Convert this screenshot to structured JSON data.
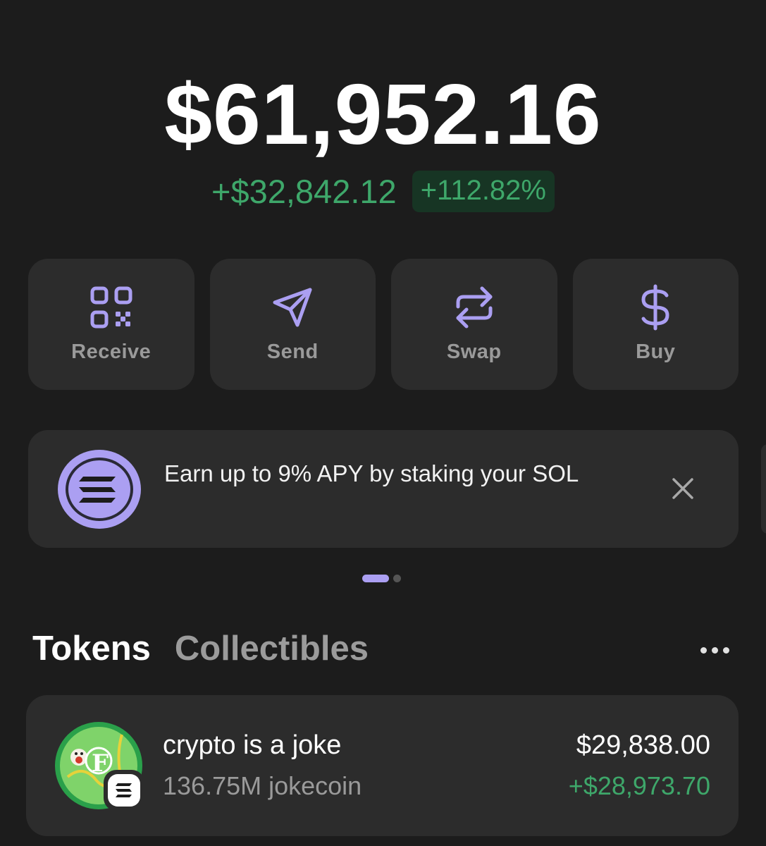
{
  "portfolio": {
    "balance": "$61,952.16",
    "change_amount": "+$32,842.12",
    "change_percent": "+112.82%"
  },
  "actions": [
    {
      "label": "Receive",
      "icon": "qr-code-icon"
    },
    {
      "label": "Send",
      "icon": "send-arrow-icon"
    },
    {
      "label": "Swap",
      "icon": "swap-arrows-icon"
    },
    {
      "label": "Buy",
      "icon": "dollar-icon"
    }
  ],
  "banner": {
    "text": "Earn up to 9% APY by staking your SOL",
    "icon": "solana-logo-icon",
    "close_icon": "close-icon"
  },
  "carousel": {
    "total_pages": 2,
    "active_page": 1
  },
  "tabs": [
    {
      "label": "Tokens",
      "active": true
    },
    {
      "label": "Collectibles",
      "active": false
    }
  ],
  "tokens": [
    {
      "name": "crypto is a joke",
      "amount": "136.75M jokecoin",
      "value": "$29,838.00",
      "change": "+$28,973.70",
      "icon": "jokecoin-avatar",
      "chain_icon": "solana-badge-icon"
    }
  ],
  "colors": {
    "background": "#1c1c1c",
    "card": "#2c2c2c",
    "accent": "#ab9ff2",
    "positive": "#3ea76a",
    "positive_bg": "#173524",
    "muted_text": "#9a9a9a"
  }
}
